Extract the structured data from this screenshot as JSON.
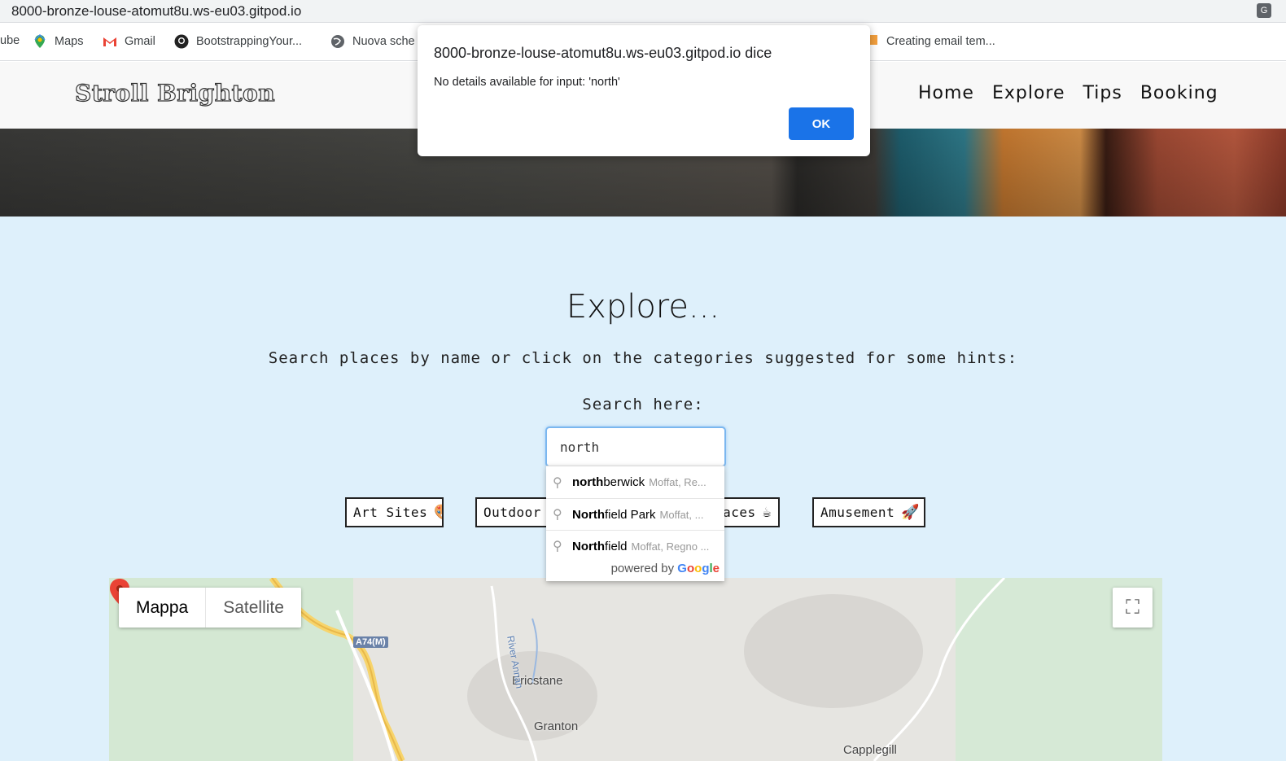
{
  "browser": {
    "url": "8000-bronze-louse-atomut8u.ws-eu03.gitpod.io",
    "bookmarks": [
      {
        "label": "ube",
        "icon": "youtube-icon"
      },
      {
        "label": "Maps",
        "icon": "maps-icon"
      },
      {
        "label": "Gmail",
        "icon": "gmail-icon"
      },
      {
        "label": "BootstrappingYour...",
        "icon": "github-icon"
      },
      {
        "label": "Nuova sche",
        "icon": "globe-icon"
      },
      {
        "label": "Creating email tem...",
        "icon": "bookmark-icon"
      }
    ]
  },
  "site": {
    "brand": "Stroll Brighton",
    "nav": [
      "Home",
      "Explore",
      "Tips",
      "Booking"
    ]
  },
  "explore": {
    "title": "Explore...",
    "subtitle": "Search places by name or click on the categories suggested for some hints:",
    "search_label": "Search here:",
    "search_value": "north",
    "categories": [
      {
        "label": "Art Sites",
        "icon": "palette-icon"
      },
      {
        "label": "Outdoor A",
        "icon": ""
      },
      {
        "label": "aces",
        "icon": "coffee-icon"
      },
      {
        "label": "Amusement",
        "icon": "rocket-icon"
      }
    ]
  },
  "autocomplete": {
    "items": [
      {
        "match": "north",
        "rest": " berwick",
        "secondary": "Moffat, Re..."
      },
      {
        "match": "North",
        "rest": "field Park",
        "secondary": "Moffat, ..."
      },
      {
        "match": "North",
        "rest": "field",
        "secondary": "Moffat, Regno ..."
      }
    ],
    "powered_by": "powered by",
    "google": "Google"
  },
  "map": {
    "type_active": "Mappa",
    "type_inactive": "Satellite",
    "labels": {
      "ericstane": "Ericstane",
      "granton": "Granton",
      "cappleg": "Capplegill",
      "river": "River Annan",
      "road": "A74(M)"
    }
  },
  "dialog": {
    "title": "8000-bronze-louse-atomut8u.ws-eu03.gitpod.io dice",
    "message": "No details available for input: 'north'",
    "ok": "OK"
  }
}
